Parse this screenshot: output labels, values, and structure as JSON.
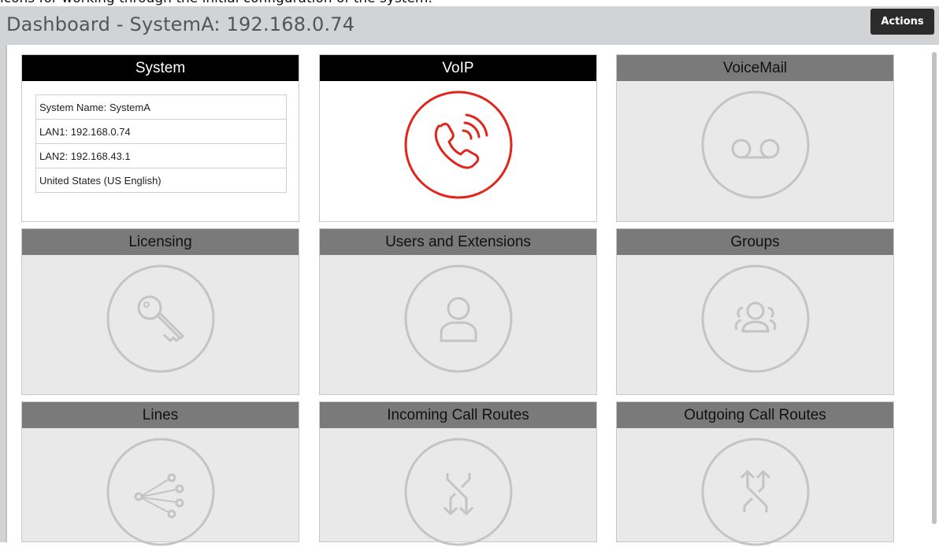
{
  "caption": "icons for working through the initial configuration of the system.",
  "header": {
    "title": "Dashboard - SystemA: 192.168.0.74",
    "actions_label": "Actions"
  },
  "tiles": {
    "system": {
      "title": "System",
      "rows": [
        "System Name: SystemA",
        "LAN1: 192.168.0.74",
        "LAN2: 192.168.43.1",
        "United States (US English)"
      ]
    },
    "voip": {
      "title": "VoIP",
      "icon": "phone-ringing-icon"
    },
    "voicemail": {
      "title": "VoiceMail",
      "icon": "voicemail-icon"
    },
    "licensing": {
      "title": "Licensing",
      "icon": "key-icon"
    },
    "users": {
      "title": "Users and Extensions",
      "icon": "user-icon"
    },
    "groups": {
      "title": "Groups",
      "icon": "group-icon"
    },
    "lines": {
      "title": "Lines",
      "icon": "lines-network-icon"
    },
    "incoming": {
      "title": "Incoming Call Routes",
      "icon": "incoming-routes-icon"
    },
    "outgoing": {
      "title": "Outgoing Call Routes",
      "icon": "outgoing-routes-icon"
    }
  },
  "colors": {
    "header_bg": "#d2d3d4",
    "active_title_bg": "#000000",
    "inactive_title_bg": "#7a7a7a",
    "voip_accent": "#e0251b",
    "inactive_icon": "#c4c4c4"
  }
}
